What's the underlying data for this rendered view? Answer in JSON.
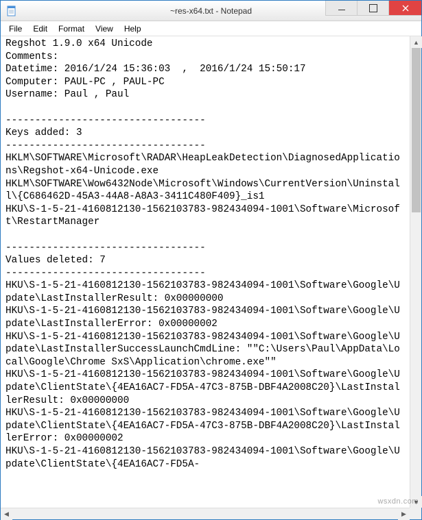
{
  "window": {
    "title": "~res-x64.txt - Notepad"
  },
  "menu": {
    "file": "File",
    "edit": "Edit",
    "format": "Format",
    "view": "View",
    "help": "Help"
  },
  "content": {
    "text": "Regshot 1.9.0 x64 Unicode\nComments:\nDatetime: 2016/1/24 15:36:03  ,  2016/1/24 15:50:17\nComputer: PAUL-PC , PAUL-PC\nUsername: Paul , Paul\n\n----------------------------------\nKeys added: 3\n----------------------------------\nHKLM\\SOFTWARE\\Microsoft\\RADAR\\HeapLeakDetection\\DiagnosedApplications\\Regshot-x64-Unicode.exe\nHKLM\\SOFTWARE\\Wow6432Node\\Microsoft\\Windows\\CurrentVersion\\Uninstall\\{C686462D-45A3-44A8-A8A3-3411C480F409}_is1\nHKU\\S-1-5-21-4160812130-1562103783-982434094-1001\\Software\\Microsoft\\RestartManager\n\n----------------------------------\nValues deleted: 7\n----------------------------------\nHKU\\S-1-5-21-4160812130-1562103783-982434094-1001\\Software\\Google\\Update\\LastInstallerResult: 0x00000000\nHKU\\S-1-5-21-4160812130-1562103783-982434094-1001\\Software\\Google\\Update\\LastInstallerError: 0x00000002\nHKU\\S-1-5-21-4160812130-1562103783-982434094-1001\\Software\\Google\\Update\\LastInstallerSuccessLaunchCmdLine: \"\"C:\\Users\\Paul\\AppData\\Local\\Google\\Chrome SxS\\Application\\chrome.exe\"\"\nHKU\\S-1-5-21-4160812130-1562103783-982434094-1001\\Software\\Google\\Update\\ClientState\\{4EA16AC7-FD5A-47C3-875B-DBF4A2008C20}\\LastInstallerResult: 0x00000000\nHKU\\S-1-5-21-4160812130-1562103783-982434094-1001\\Software\\Google\\Update\\ClientState\\{4EA16AC7-FD5A-47C3-875B-DBF4A2008C20}\\LastInstallerError: 0x00000002\nHKU\\S-1-5-21-4160812130-1562103783-982434094-1001\\Software\\Google\\Update\\ClientState\\{4EA16AC7-FD5A-"
  },
  "watermark": "wsxdn.com"
}
